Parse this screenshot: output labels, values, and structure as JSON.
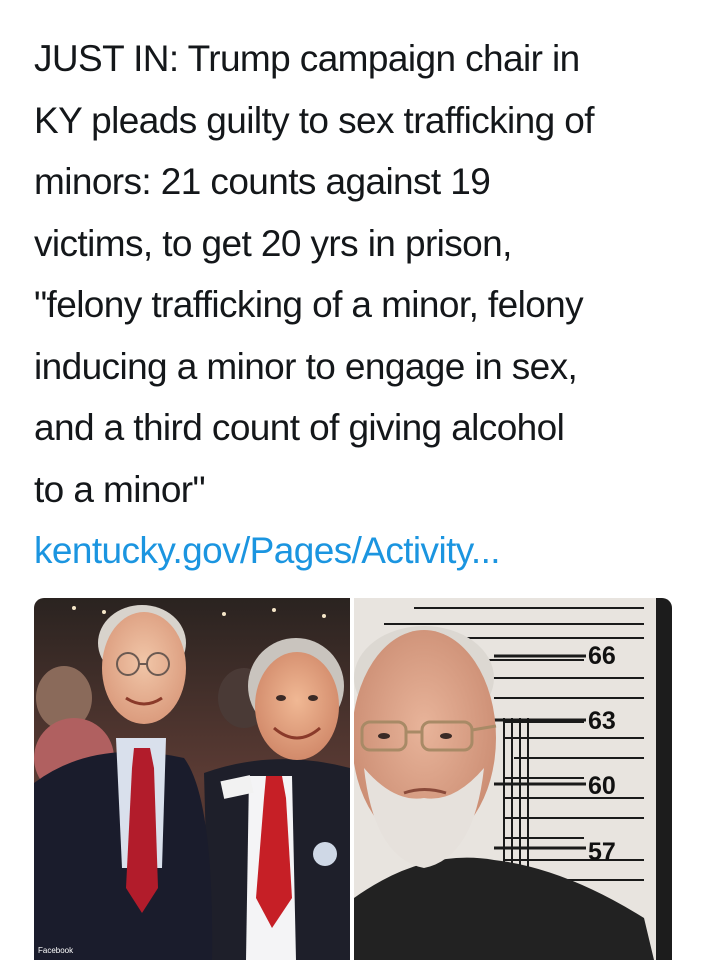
{
  "tweet": {
    "lines": [
      "JUST IN: Trump campaign chair in",
      "KY pleads guilty to sex trafficking of",
      "minors: 21 counts against 19",
      "victims, to get 20 yrs in prison,",
      "\"felony trafficking of a minor, felony",
      "inducing a minor to engage in sex,",
      "and a third count of giving alcohol",
      "to a minor\""
    ],
    "link_text": "kentucky.gov/Pages/Activity..."
  },
  "photos": {
    "left": {
      "watermark": "Facebook"
    },
    "right": {
      "height_marks": [
        "66",
        "63",
        "60",
        "57"
      ]
    }
  },
  "colors": {
    "text": "#14171a",
    "link": "#1b95e0",
    "background": "#ffffff"
  }
}
